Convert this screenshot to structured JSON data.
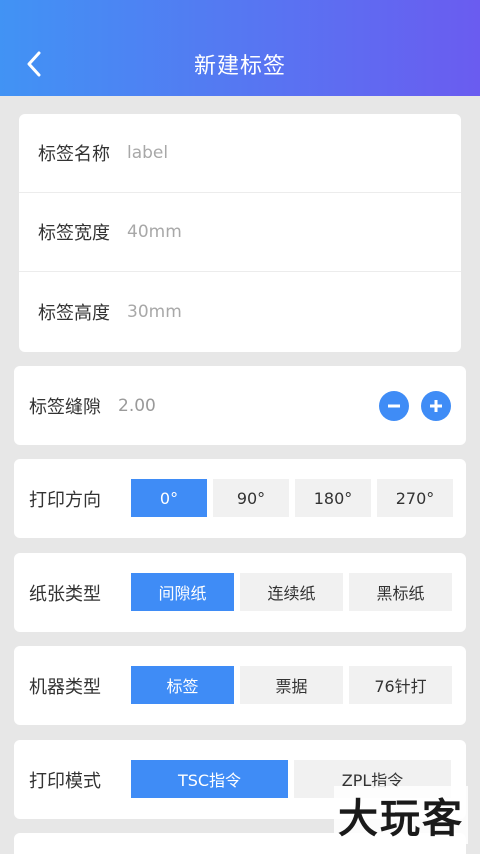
{
  "header": {
    "title": "新建标签"
  },
  "basic": {
    "name_label": "标签名称",
    "name_placeholder": "label",
    "width_label": "标签宽度",
    "width_placeholder": "40mm",
    "height_label": "标签高度",
    "height_placeholder": "30mm"
  },
  "gap": {
    "label": "标签缝隙",
    "value": "2.00"
  },
  "direction": {
    "label": "打印方向",
    "options": [
      "0°",
      "90°",
      "180°",
      "270°"
    ],
    "selected": "0°"
  },
  "paper": {
    "label": "纸张类型",
    "options": [
      "间隙纸",
      "连续纸",
      "黑标纸"
    ],
    "selected": "间隙纸"
  },
  "machine": {
    "label": "机器类型",
    "options": [
      "标签",
      "票据",
      "76针打"
    ],
    "selected": "标签"
  },
  "mode": {
    "label": "打印模式",
    "options": [
      "TSC指令",
      "ZPL指令"
    ],
    "selected": "TSC指令"
  },
  "watermark": "大玩客",
  "colors": {
    "accent": "#3f8cf6",
    "header_start": "#4193f4",
    "header_end": "#6a5cf0"
  }
}
